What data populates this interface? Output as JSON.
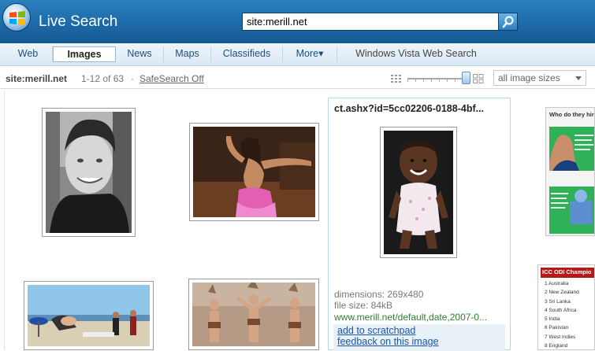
{
  "header": {
    "brand": "Live Search",
    "search_value": "site:merill.net"
  },
  "tabs": [
    {
      "label": "Web"
    },
    {
      "label": "Images"
    },
    {
      "label": "News"
    },
    {
      "label": "Maps"
    },
    {
      "label": "Classifieds"
    },
    {
      "label": "More▾"
    },
    {
      "label": "Windows Vista Web Search"
    }
  ],
  "results": {
    "query": "site:merill.net",
    "count": "1-12 of 63",
    "separator": "·",
    "safesearch": "SafeSearch Off",
    "size_filter": "all image sizes"
  },
  "detail": {
    "title": "ct.ashx?id=5cc02206-0188-4bf...",
    "dimensions": "dimensions: 269x480",
    "file_size": "file size: 84kB",
    "url": "www.merill.net/default,date,2007-0...",
    "action_scratchpad": "add to scratchpad",
    "action_feedback": "feedback on this image"
  },
  "ads": {
    "ad1_headline": "Who do they hire?",
    "ad2_header": "ICC ODI Champio",
    "ad2_rows": [
      "1 Australia",
      "2 New Zealand",
      "3 Sri Lanka",
      "4 South Africa",
      "5 India",
      "6 Pakistan",
      "7 West Indies",
      "8 England"
    ]
  },
  "colors": {
    "header_blue": "#1d6aa8",
    "url_green": "#2e7d32",
    "link_blue": "#1d55a5"
  }
}
